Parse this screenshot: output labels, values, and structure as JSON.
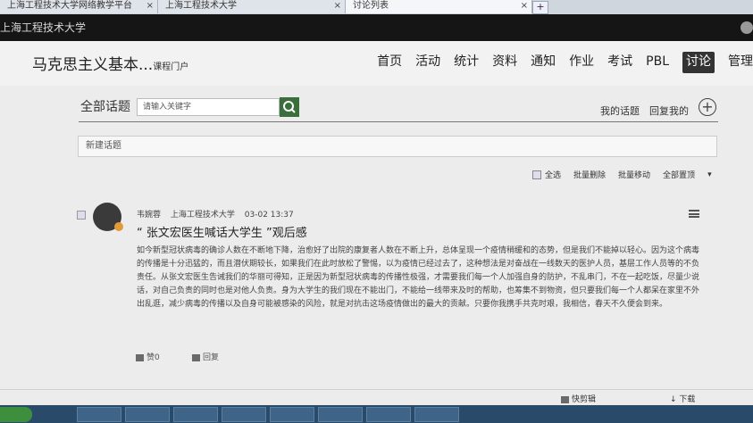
{
  "browser": {
    "tabs": [
      {
        "label": "上海工程技术大学网络教学平台",
        "close": "×"
      },
      {
        "label": "上海工程技术大学",
        "close": "×"
      },
      {
        "label": "讨论列表",
        "close": "×"
      }
    ],
    "new_tab": "+"
  },
  "site": {
    "name": "上海工程技术大学"
  },
  "course": {
    "title": "马克思主义基本...",
    "subtitle": "课程门户"
  },
  "nav": [
    "首页",
    "活动",
    "统计",
    "资料",
    "通知",
    "作业",
    "考试",
    "PBL",
    "讨论",
    "管理"
  ],
  "topics": {
    "label": "全部话题",
    "search_placeholder": "请输入关键字",
    "my_topics": "我的话题",
    "reply_mine": "回复我的",
    "add": "+",
    "new_topic": "新建话题",
    "tools": {
      "select_all": "全选",
      "batch_delete": "批量删除",
      "batch_move": "批量移动",
      "top": "全部置顶",
      "more": "▾"
    }
  },
  "post": {
    "author": "韦婉蓉",
    "school": "上海工程技术大学",
    "time": "03-02 13:37",
    "title": "“ 张文宏医生喊话大学生 ”观后感",
    "body": "如今新型冠状病毒的确诊人数在不断地下降，治愈好了出院的康复者人数在不断上升，总体呈现一个疫情稍缓和的态势，但是我们不能掉以轻心。因为这个病毒的传播是十分迅猛的，而且潜伏期较长，如果我们在此时放松了警惕，以为疫情已经过去了，这种想法是对奋战在一线数天的医护人员，基层工作人员等的不负责任。从张文宏医生告诫我们的华丽可得知，正是因为新型冠状病毒的传播性极强，才需要我们每一个人加强自身的防护，不乱串门，不在一起吃饭，尽量少说话，对自己负责的同时也是对他人负责。身为大学生的我们现在不能出门，不能给一线带来及时的帮助，也筹集不到物资，但只要我们每一个人都呆在家里不外出乱逛，减少病毒的传播以及自身可能被感染的风险，就是对抗击这场疫情做出的最大的贡献。只要你我携手共克时艰，我相信，春天不久便会到来。",
    "like": "赞0",
    "reply": "回复"
  },
  "bottombar": {
    "quick_clip": "快剪辑",
    "download": "下载"
  }
}
